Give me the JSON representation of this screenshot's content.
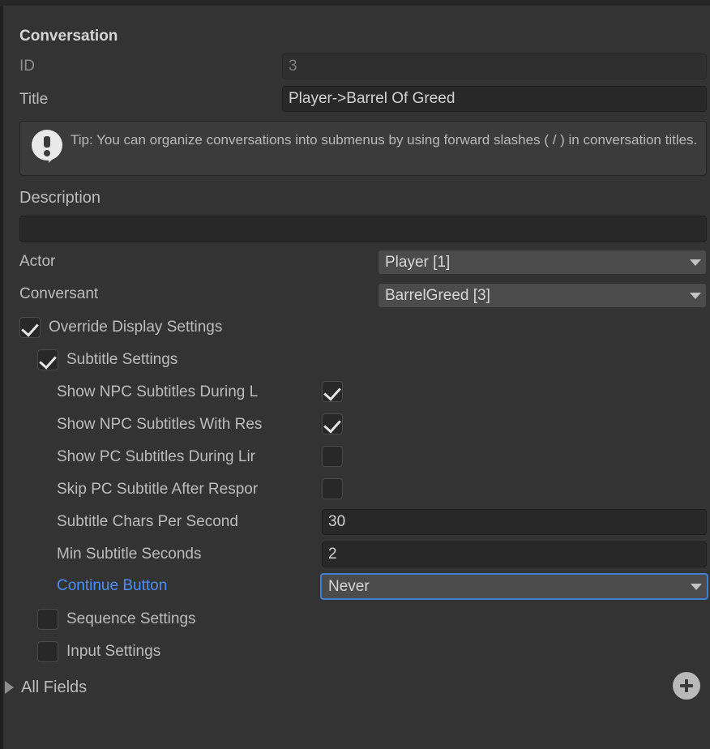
{
  "window": {
    "background_color": "#333333",
    "accent_color": "#4c8ffb",
    "focus_border_color": "#3e7fd4"
  },
  "section": {
    "title": "Conversation"
  },
  "fields": {
    "id": {
      "label": "ID",
      "value": "3",
      "disabled": true
    },
    "title": {
      "label": "Title",
      "value": "Player->Barrel Of Greed"
    },
    "description": {
      "label": "Description",
      "value": ""
    },
    "actor": {
      "label": "Actor",
      "value": "Player [1]"
    },
    "conversant": {
      "label": "Conversant",
      "value": "BarrelGreed [3]"
    }
  },
  "tip": {
    "icon": "speech-bubble-exclamation-icon",
    "text": "Tip: You can organize conversations into submenus by using forward slashes ( / ) in conversation titles."
  },
  "toggles": {
    "override_display_settings": {
      "label": "Override Display Settings",
      "checked": true
    },
    "subtitle_settings": {
      "label": "Subtitle Settings",
      "checked": true
    },
    "sequence_settings": {
      "label": "Sequence Settings",
      "checked": false
    },
    "input_settings": {
      "label": "Input Settings",
      "checked": false
    }
  },
  "subtitle_settings": {
    "rows": [
      {
        "label": "Show NPC Subtitles During L",
        "checked": true
      },
      {
        "label": "Show NPC Subtitles With Res",
        "checked": true
      },
      {
        "label": "Show PC Subtitles During Lir",
        "checked": false
      },
      {
        "label": "Skip PC Subtitle After Respor",
        "checked": false
      }
    ],
    "chars_per_second": {
      "label": "Subtitle Chars Per Second",
      "value": "30"
    },
    "min_subtitle_seconds": {
      "label": "Min Subtitle Seconds",
      "value": "2"
    },
    "continue_button": {
      "label": "Continue Button",
      "value": "Never",
      "highlighted": true
    }
  },
  "all_fields": {
    "label": "All Fields",
    "expanded": false,
    "add_button_icon": "plus-circle-icon"
  }
}
